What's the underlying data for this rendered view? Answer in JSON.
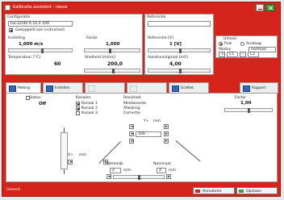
{
  "window": {
    "title": "Kalibratie assistent - nieuw"
  },
  "panels": {
    "config": {
      "heading": "Configuratie",
      "name_field": "Isa 22/40 R 10 2 10V",
      "option_label": "Gekoppeld aan instrument",
      "option_checked": true,
      "param1_label": "Instelling",
      "param1_value": "1,000 m/s",
      "param2_label": "Factor",
      "param2_value": "1,000",
      "temp_label": "Temperatuur [°C]",
      "temp_value": "60",
      "speed_label": "Snelheid [mm/s]",
      "speed_value": "200,0"
    },
    "reference": {
      "heading": "Referentie",
      "field_value": "",
      "ref_label": "Referentie [V]",
      "ref_value": "1 [V]",
      "signal_label": "Aanstuursignaal [mV]",
      "signal_value": "4,00"
    },
    "output": {
      "heading": "Uitvoer",
      "radio1": "Puls",
      "radio2": "Analoog",
      "mode_label": "Modus",
      "mode_value": "normaal",
      "mode_options_a": [
        "C1",
        "C2"
      ],
      "btn_plus": "+",
      "btn_minus": "-"
    }
  },
  "tabs": [
    {
      "label": "Meting"
    },
    {
      "label": "Instellen"
    },
    {
      "label": ""
    },
    {
      "label": ""
    },
    {
      "label": "Grafiek"
    },
    {
      "label": "Rapport"
    }
  ],
  "tab_content": {
    "status_label": "Status",
    "status_value": "Off",
    "channel_heading": "Kanalen",
    "channels": [
      "Kanaal 1",
      "Kanaal 2",
      "Kanaal 3"
    ],
    "result_heading": "Resultaat",
    "result_lines": [
      "Meetwaarde",
      "Afwijking",
      "Correctie"
    ],
    "right_label": "Factor",
    "right_value": "1,00",
    "diagram": {
      "top_label": "Y+",
      "top_unit": "mm",
      "mid_value": "100",
      "left_label": "X+",
      "left_unit": "mm",
      "bottom_left_label": "Werkelijk",
      "bottom_left_value": "2",
      "bottom_right_label": "Nominaal",
      "bottom_right_value": "2",
      "unit": "mm"
    }
  },
  "statusbar": {
    "text": "Gereed",
    "cancel_label": "Annuleren",
    "ok_label": "Opslaan"
  }
}
